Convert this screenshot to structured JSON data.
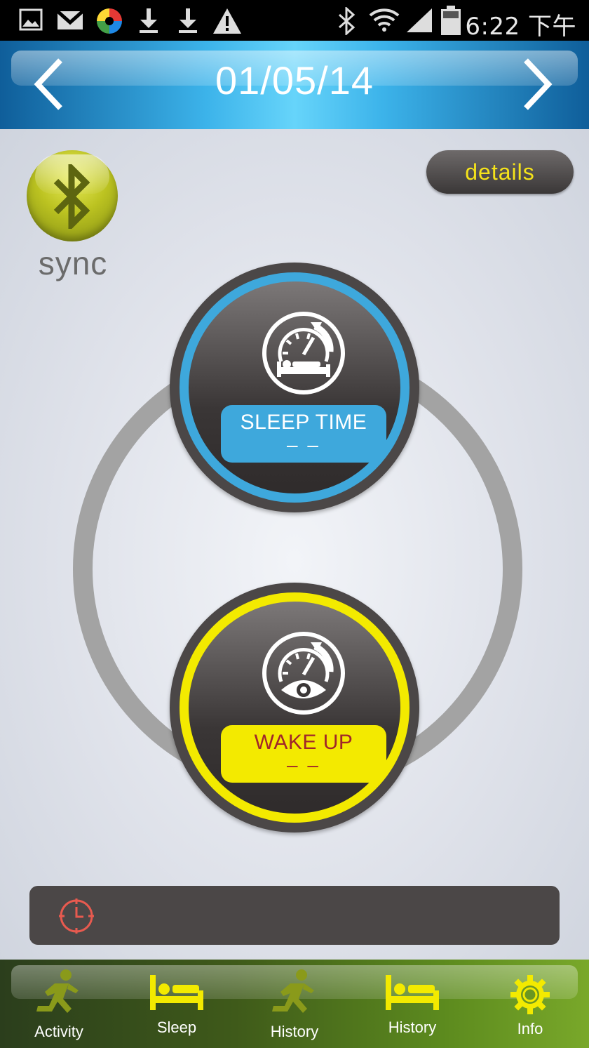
{
  "status_bar": {
    "time": "6:22 下午",
    "icons": [
      "gallery-icon",
      "gmail-icon",
      "app-icon",
      "download-icon",
      "download-icon",
      "warning-icon",
      "bluetooth-icon",
      "wifi-icon",
      "signal-icon",
      "battery-icon"
    ]
  },
  "header": {
    "date": "01/05/14",
    "prev_icon": "chevron-left-icon",
    "next_icon": "chevron-right-icon"
  },
  "sync": {
    "label": "sync",
    "icon": "bluetooth-icon"
  },
  "details": {
    "label": "details"
  },
  "sleep_dial": {
    "title": "SLEEP TIME",
    "value": "– –",
    "icon": "sleep-gauge-icon",
    "color": "#3ea8dc"
  },
  "wake_dial": {
    "title": "WAKE UP",
    "value": "– –",
    "icon": "wake-gauge-icon",
    "color": "#f3ea00"
  },
  "alarm": {
    "icon": "clock-icon",
    "text": ""
  },
  "tabs": [
    {
      "label": "Activity",
      "icon": "runner-icon"
    },
    {
      "label": "Sleep",
      "icon": "bed-icon"
    },
    {
      "label": "History",
      "icon": "runner-icon"
    },
    {
      "label": "History",
      "icon": "bed-icon"
    },
    {
      "label": "Info",
      "icon": "gear-icon"
    }
  ],
  "colors": {
    "header_blue": "#3cb3ea",
    "sleep_blue": "#3ea8dc",
    "wake_yellow": "#f3ea00",
    "details_text": "#f5e31a",
    "tab_icon": "#f3ea00"
  }
}
